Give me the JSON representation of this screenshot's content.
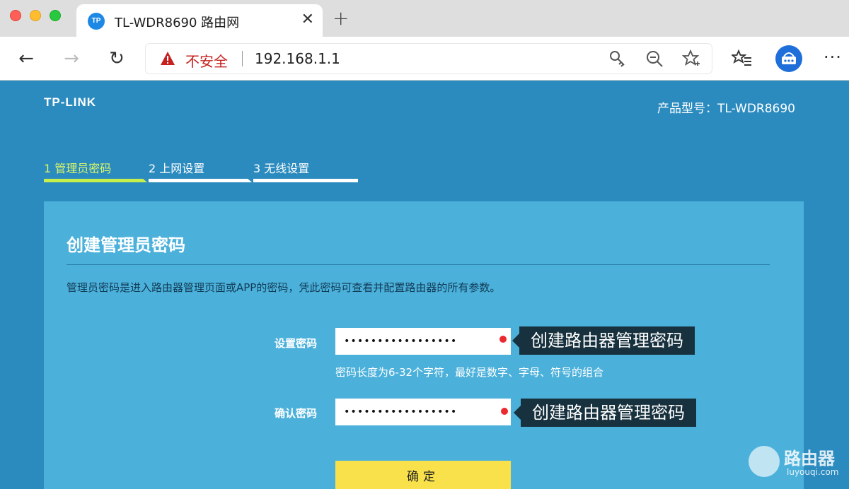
{
  "browser": {
    "tab": {
      "favicon_text": "TP",
      "title": "TL-WDR8690 路由网",
      "close_glyph": "✕"
    },
    "new_tab_glyph": "+",
    "omnibox": {
      "security_label": "不安全",
      "url": "192.168.1.1"
    },
    "icons": {
      "back": "←",
      "forward": "→",
      "reload": "↻",
      "key": "🔑",
      "zoom": "⊖",
      "star": "☆",
      "favorites_list": "☆≡",
      "more": "···"
    }
  },
  "page": {
    "logo": "TP-LINK",
    "model": "产品型号：TL-WDR8690",
    "steps": [
      {
        "label": "1 管理员密码"
      },
      {
        "label": "2 上网设置"
      },
      {
        "label": "3 无线设置"
      }
    ],
    "panel": {
      "title": "创建管理员密码",
      "description": "管理员密码是进入路由器管理页面或APP的密码，凭此密码可查看并配置路由器的所有参数。",
      "set_password": {
        "label": "设置密码",
        "value": "•••••••••••••••••",
        "callout": "创建路由器管理密码"
      },
      "hint": "密码长度为6-32个字符，最好是数字、字母、符号的组合",
      "confirm_password": {
        "label": "确认密码",
        "value": "•••••••••••••••••",
        "callout": "创建路由器管理密码"
      },
      "confirm_button": "确定"
    },
    "watermark": {
      "title": "路由器",
      "sub": "luyouqi.com"
    }
  },
  "colors": {
    "page_bg": "#2b8bbf",
    "panel_bg": "#4bb1db",
    "step_active": "#c7ef4b",
    "button": "#f9e14b",
    "required_dot": "#ea2a2f",
    "callout_bg": "#17313e"
  }
}
